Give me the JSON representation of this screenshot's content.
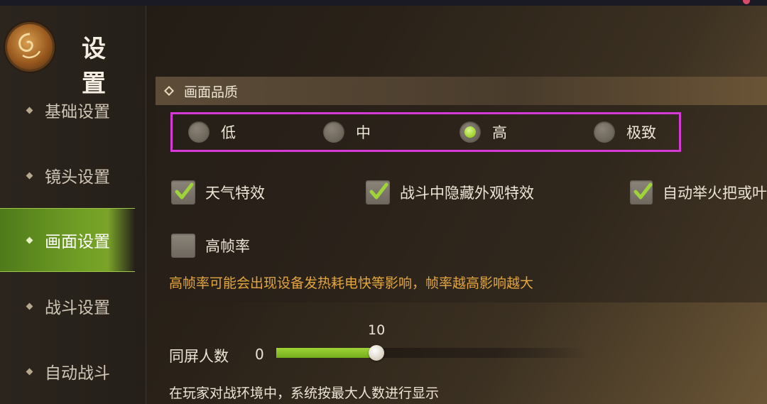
{
  "header": {
    "title": "设 置"
  },
  "sidebar": {
    "items": [
      {
        "label": "基础设置",
        "active": false
      },
      {
        "label": "镜头设置",
        "active": false
      },
      {
        "label": "画面设置",
        "active": true
      },
      {
        "label": "战斗设置",
        "active": false
      },
      {
        "label": "自动战斗",
        "active": false
      }
    ]
  },
  "section": {
    "title": "画面品质"
  },
  "quality": {
    "options": [
      "低",
      "中",
      "高",
      "极致"
    ],
    "selected": "高"
  },
  "checkboxes": {
    "weather": {
      "label": "天气特效",
      "checked": true
    },
    "hide_appearance": {
      "label": "战斗中隐藏外观特效",
      "checked": true
    },
    "auto_torch": {
      "label": "自动举火把或叶",
      "checked": true
    },
    "high_fps": {
      "label": "高帧率",
      "checked": false
    }
  },
  "fps_note": "高帧率可能会出现设备发热耗电快等影响，帧率越高影响越大",
  "slider": {
    "label": "同屏人数",
    "min_label": "0",
    "value_label": "10",
    "fraction": 0.32,
    "note": "在玩家对战环境中，系统按最大人数进行显示"
  },
  "colors": {
    "accent_green": "#7aa428",
    "highlight_border": "#d63ad6",
    "note_orange": "#e2a640"
  }
}
